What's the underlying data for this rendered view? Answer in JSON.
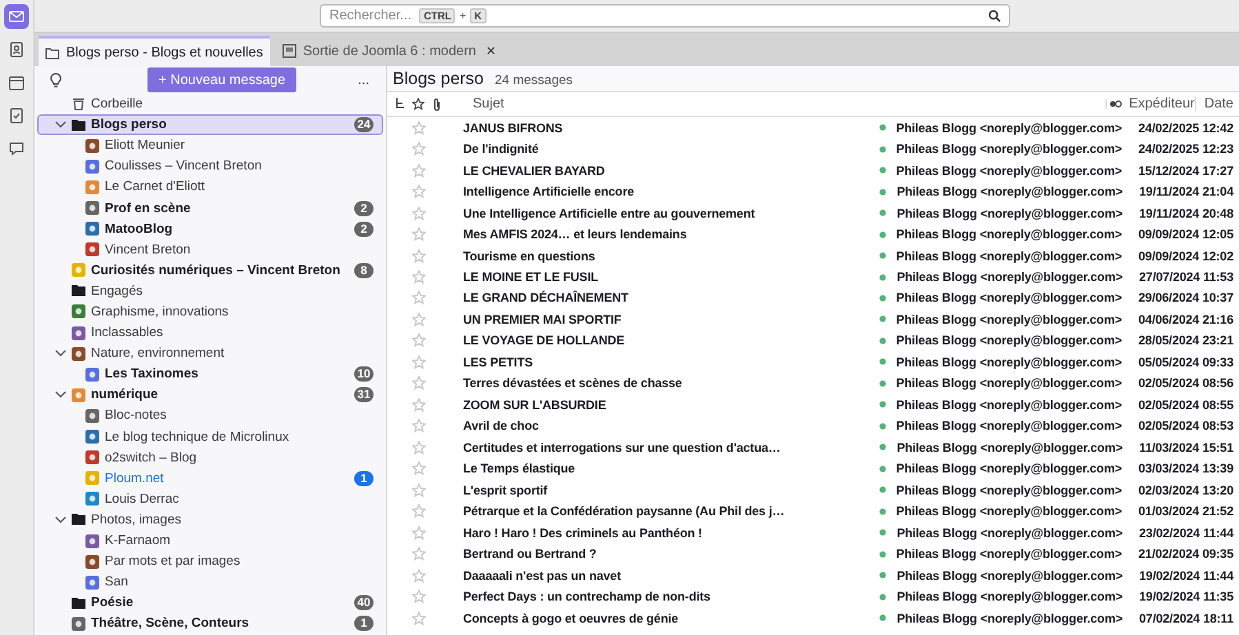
{
  "spaces": [
    {
      "kind": "mail",
      "selected": true
    },
    {
      "kind": "contacts",
      "selected": false
    },
    {
      "kind": "calendar",
      "selected": false
    },
    {
      "kind": "tasks",
      "selected": false
    },
    {
      "kind": "chat",
      "selected": false
    }
  ],
  "search": {
    "placeholder": "Rechercher...",
    "shortcut_keys": [
      "CTRL",
      "K"
    ],
    "shortcut_joiner": "+"
  },
  "tabs": [
    {
      "label": "Blogs perso - Blogs et nouvelles",
      "kind": "folder",
      "selected": true
    },
    {
      "label": "Sortie de Joomla 6 : modern",
      "kind": "message",
      "selected": false,
      "close": "✕"
    }
  ],
  "folder_pane": {
    "new_message_button": "+ Nouveau message",
    "menu": "...",
    "folders": [
      {
        "label": "Corbeille",
        "kind": "trash",
        "unread": false,
        "selected": false
      },
      {
        "label": "Blogs perso",
        "kind": "folder",
        "unread": true,
        "count": "24",
        "selected": true,
        "expanded": true,
        "children": [
          {
            "label": "Eliott Meunier",
            "kind": "feed",
            "unread": false,
            "selected": false
          },
          {
            "label": "Coulisses – Vincent Breton",
            "kind": "feed",
            "unread": false,
            "selected": false
          },
          {
            "label": "Le Carnet d'Eliott",
            "kind": "feed",
            "unread": false,
            "selected": false
          },
          {
            "label": "Prof en scène",
            "kind": "feed",
            "unread": true,
            "count": "2",
            "selected": false
          },
          {
            "label": "MatooBlog",
            "kind": "feed",
            "unread": true,
            "count": "2",
            "selected": false
          },
          {
            "label": "Vincent Breton",
            "kind": "feed",
            "unread": false,
            "selected": false
          }
        ]
      },
      {
        "label": "Curiosités numériques – Vincent Breton",
        "kind": "feed",
        "unread": true,
        "count": "8",
        "selected": false
      },
      {
        "label": "Engagés",
        "kind": "folder",
        "unread": false,
        "selected": false
      },
      {
        "label": "Graphisme, innovations",
        "kind": "feed",
        "unread": false,
        "selected": false
      },
      {
        "label": "Inclassables",
        "kind": "feed",
        "unread": false,
        "selected": false
      },
      {
        "label": "Nature, environnement",
        "kind": "feed",
        "unread": false,
        "selected": false,
        "expanded": true,
        "children": [
          {
            "label": "Les Taxinomes",
            "kind": "feed",
            "unread": true,
            "count": "10",
            "selected": false
          }
        ]
      },
      {
        "label": "numérique",
        "kind": "feed",
        "unread": true,
        "count": "31",
        "selected": false,
        "expanded": true,
        "children": [
          {
            "label": "Bloc-notes",
            "kind": "feed",
            "unread": false,
            "selected": false
          },
          {
            "label": "Le blog technique de Microlinux",
            "kind": "feed",
            "unread": false,
            "selected": false
          },
          {
            "label": "o2switch – Blog",
            "kind": "feed",
            "unread": false,
            "selected": false
          },
          {
            "label": "Ploum.net",
            "kind": "feed",
            "unread": false,
            "new": true,
            "count": "1",
            "selected": false
          },
          {
            "label": "Louis Derrac",
            "kind": "feed",
            "unread": false,
            "selected": false
          }
        ]
      },
      {
        "label": "Photos, images",
        "kind": "folder",
        "unread": false,
        "selected": false,
        "expanded": true,
        "children": [
          {
            "label": "K-Farnaom",
            "kind": "feed",
            "unread": false,
            "selected": false
          },
          {
            "label": "Par mots et par images",
            "kind": "feed",
            "unread": false,
            "selected": false
          },
          {
            "label": "San",
            "kind": "feed",
            "unread": false,
            "selected": false
          }
        ]
      },
      {
        "label": "Poésie",
        "kind": "folder",
        "unread": true,
        "count": "40",
        "selected": false
      },
      {
        "label": "Théâtre, Scène, Conteurs",
        "kind": "feed",
        "unread": true,
        "count": "1",
        "selected": false
      }
    ]
  },
  "message_list": {
    "title": "Blogs perso",
    "message_count": "24 messages",
    "columns": [
      "Sujet",
      "Expéditeur",
      "Date"
    ],
    "rows": [
      {
        "subject": "JANUS BIFRONS",
        "sender": "Phileas Blogg <noreply@blogger.com>",
        "date": "24/02/2025 12:42",
        "unread": true,
        "starred": false
      },
      {
        "subject": "De l'indignité",
        "sender": "Phileas Blogg <noreply@blogger.com>",
        "date": "24/02/2025 12:23",
        "unread": true,
        "starred": false
      },
      {
        "subject": "LE CHEVALIER BAYARD",
        "sender": "Phileas Blogg <noreply@blogger.com>",
        "date": "15/12/2024 17:27",
        "unread": true,
        "starred": false
      },
      {
        "subject": "Intelligence Artificielle encore",
        "sender": "Phileas Blogg <noreply@blogger.com>",
        "date": "19/11/2024 21:04",
        "unread": true,
        "starred": false
      },
      {
        "subject": "Une Intelligence Artificielle entre au gouvernement",
        "sender": "Phileas Blogg <noreply@blogger.com>",
        "date": "19/11/2024 20:48",
        "unread": true,
        "starred": false
      },
      {
        "subject": "Mes AMFIS 2024… et leurs lendemains",
        "sender": "Phileas Blogg <noreply@blogger.com>",
        "date": "09/09/2024 12:05",
        "unread": true,
        "starred": false
      },
      {
        "subject": "Tourisme en questions",
        "sender": "Phileas Blogg <noreply@blogger.com>",
        "date": "09/09/2024 12:02",
        "unread": true,
        "starred": false
      },
      {
        "subject": "LE MOINE ET LE FUSIL",
        "sender": "Phileas Blogg <noreply@blogger.com>",
        "date": "27/07/2024 11:53",
        "unread": true,
        "starred": false
      },
      {
        "subject": "LE GRAND DÉCHAÎNEMENT",
        "sender": "Phileas Blogg <noreply@blogger.com>",
        "date": "29/06/2024 10:37",
        "unread": true,
        "starred": false
      },
      {
        "subject": "UN PREMIER MAI SPORTIF",
        "sender": "Phileas Blogg <noreply@blogger.com>",
        "date": "04/06/2024 21:16",
        "unread": true,
        "starred": false
      },
      {
        "subject": "LE VOYAGE DE HOLLANDE",
        "sender": "Phileas Blogg <noreply@blogger.com>",
        "date": "28/05/2024 23:21",
        "unread": true,
        "starred": false
      },
      {
        "subject": "LES PETITS",
        "sender": "Phileas Blogg <noreply@blogger.com>",
        "date": "05/05/2024 09:33",
        "unread": true,
        "starred": false
      },
      {
        "subject": "Terres dévastées et scènes de chasse",
        "sender": "Phileas Blogg <noreply@blogger.com>",
        "date": "02/05/2024 08:56",
        "unread": true,
        "starred": false
      },
      {
        "subject": "ZOOM SUR L'ABSURDIE",
        "sender": "Phileas Blogg <noreply@blogger.com>",
        "date": "02/05/2024 08:55",
        "unread": true,
        "starred": false
      },
      {
        "subject": "Avril de choc",
        "sender": "Phileas Blogg <noreply@blogger.com>",
        "date": "02/05/2024 08:53",
        "unread": true,
        "starred": false
      },
      {
        "subject": "Certitudes et interrogations sur une question d'actua…",
        "sender": "Phileas Blogg <noreply@blogger.com>",
        "date": "11/03/2024 15:51",
        "unread": true,
        "starred": false
      },
      {
        "subject": "Le Temps élastique",
        "sender": "Phileas Blogg <noreply@blogger.com>",
        "date": "03/03/2024 13:39",
        "unread": true,
        "starred": false
      },
      {
        "subject": "L'esprit sportif",
        "sender": "Phileas Blogg <noreply@blogger.com>",
        "date": "02/03/2024 13:20",
        "unread": true,
        "starred": false
      },
      {
        "subject": "Pétrarque et la Confédération paysanne (Au Phil des j…",
        "sender": "Phileas Blogg <noreply@blogger.com>",
        "date": "01/03/2024 21:52",
        "unread": true,
        "starred": false
      },
      {
        "subject": "Haro ! Haro ! Des criminels au Panthéon !",
        "sender": "Phileas Blogg <noreply@blogger.com>",
        "date": "23/02/2024 11:44",
        "unread": true,
        "starred": false
      },
      {
        "subject": "Bertrand ou Bertrand ?",
        "sender": "Phileas Blogg <noreply@blogger.com>",
        "date": "21/02/2024 09:35",
        "unread": true,
        "starred": false
      },
      {
        "subject": "Daaaaali n'est pas un navet",
        "sender": "Phileas Blogg <noreply@blogger.com>",
        "date": "19/02/2024 11:44",
        "unread": true,
        "starred": false
      },
      {
        "subject": "Perfect Days : un contrechamp de non-dits",
        "sender": "Phileas Blogg <noreply@blogger.com>",
        "date": "19/02/2024 11:35",
        "unread": true,
        "starred": false
      },
      {
        "subject": "Concepts à gogo et oeuvres de génie",
        "sender": "Phileas Blogg <noreply@blogger.com>",
        "date": "07/02/2024 18:11",
        "unread": true,
        "starred": false
      }
    ]
  }
}
